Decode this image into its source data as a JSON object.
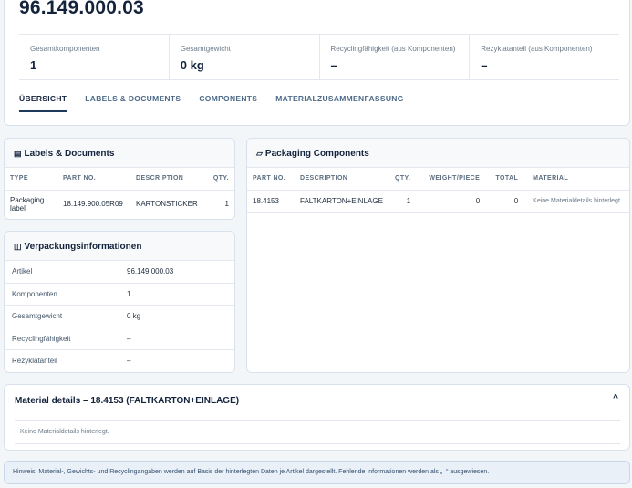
{
  "header": {
    "title": "96.149.000.03",
    "stats": [
      {
        "label": "Gesamtkomponenten",
        "value": "1"
      },
      {
        "label": "Gesamtgewicht",
        "value": "0 kg"
      },
      {
        "label": "Recyclingfähigkeit (aus Komponenten)",
        "value": "–"
      },
      {
        "label": "Rezyklatanteil (aus Komponenten)",
        "value": "–"
      }
    ],
    "tabs": [
      "ÜBERSICHT",
      "LABELS & DOCUMENTS",
      "COMPONENTS",
      "MATERIALZUSAMMENFASSUNG"
    ]
  },
  "labels_documents": {
    "title": "Labels & Documents",
    "columns": [
      "TYPE",
      "PART NO.",
      "DESCRIPTION",
      "QTY."
    ],
    "rows": [
      {
        "type": "Packaging label",
        "part_no": "18.149.900.05R09",
        "description": "KARTONSTICKER",
        "qty": "1"
      }
    ]
  },
  "packaging_info": {
    "title": "Verpackungsinformationen",
    "rows": [
      {
        "label": "Artikel",
        "value": "96.149.000.03"
      },
      {
        "label": "Komponenten",
        "value": "1"
      },
      {
        "label": "Gesamtgewicht",
        "value": "0 kg"
      },
      {
        "label": "Recyclingfähigkeit",
        "value": "–"
      },
      {
        "label": "Rezyklatanteil",
        "value": "–"
      }
    ]
  },
  "packaging_components": {
    "title": "Packaging Components",
    "columns": [
      "PART NO.",
      "DESCRIPTION",
      "QTY.",
      "WEIGHT/PIECE",
      "TOTAL",
      "MATERIAL"
    ],
    "rows": [
      {
        "part_no": "18.4153",
        "description": "FALTKARTON+EINLAGE",
        "qty": "1",
        "weight": "0",
        "total": "0",
        "material": "Keine Materialdetails hinterlegt"
      }
    ]
  },
  "material_details": {
    "title": "Material details – 18.4153 (FALTKARTON+EINLAGE)",
    "caret": "^",
    "empty_text": "Keine Materialdetails hinterlegt."
  },
  "hint": "Hinweis: Material-, Gewichts- und Recyclingangaben werden auf Basis der hinterlegten Daten je Artikel dargestellt. Fehlende Informationen werden als „–“ ausgewiesen."
}
